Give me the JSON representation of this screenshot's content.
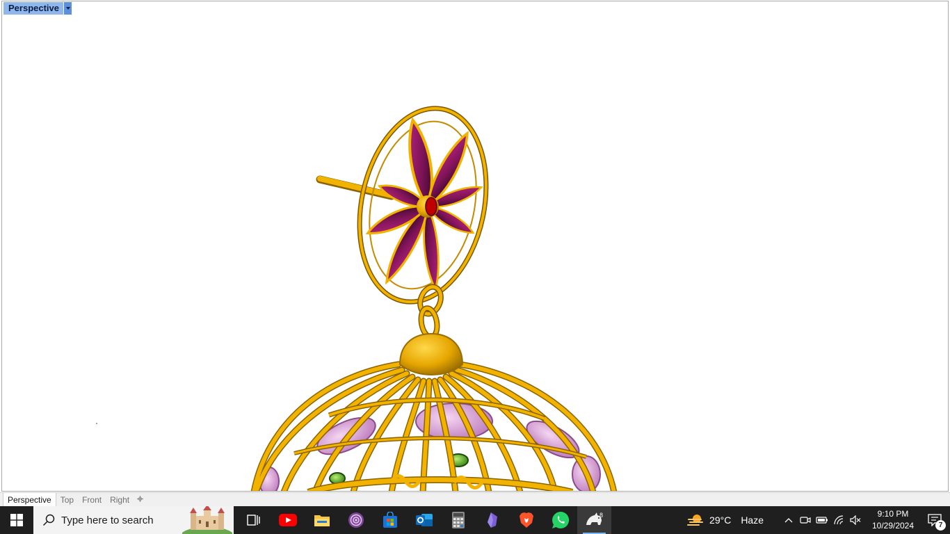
{
  "viewport": {
    "title": "Perspective",
    "model_colors": {
      "gold": "#f2b300",
      "gold_dark": "#8a6200",
      "petal": "#9c1b6b",
      "petal_dark": "#3c0a2a",
      "pink_gem": "#d59ad4",
      "green_gem": "#5ab521",
      "red_gem": "#c00000"
    }
  },
  "viewport_tabs": {
    "tabs": [
      "Perspective",
      "Top",
      "Front",
      "Right"
    ],
    "add_icon": "plus-icon"
  },
  "taskbar": {
    "search_placeholder": "Type here to search",
    "apps": [
      "task-view-icon",
      "youtube-icon",
      "file-explorer-icon",
      "tor-browser-icon",
      "microsoft-store-icon",
      "outlook-icon",
      "calculator-icon",
      "obsidian-icon",
      "brave-icon",
      "whatsapp-icon",
      "rhino-8-icon"
    ],
    "rhino_badge": "8",
    "weather": {
      "temp": "29°C",
      "condition": "Haze"
    },
    "clock": {
      "time": "9:10 PM",
      "date": "10/29/2024"
    },
    "notification_count": "7"
  }
}
